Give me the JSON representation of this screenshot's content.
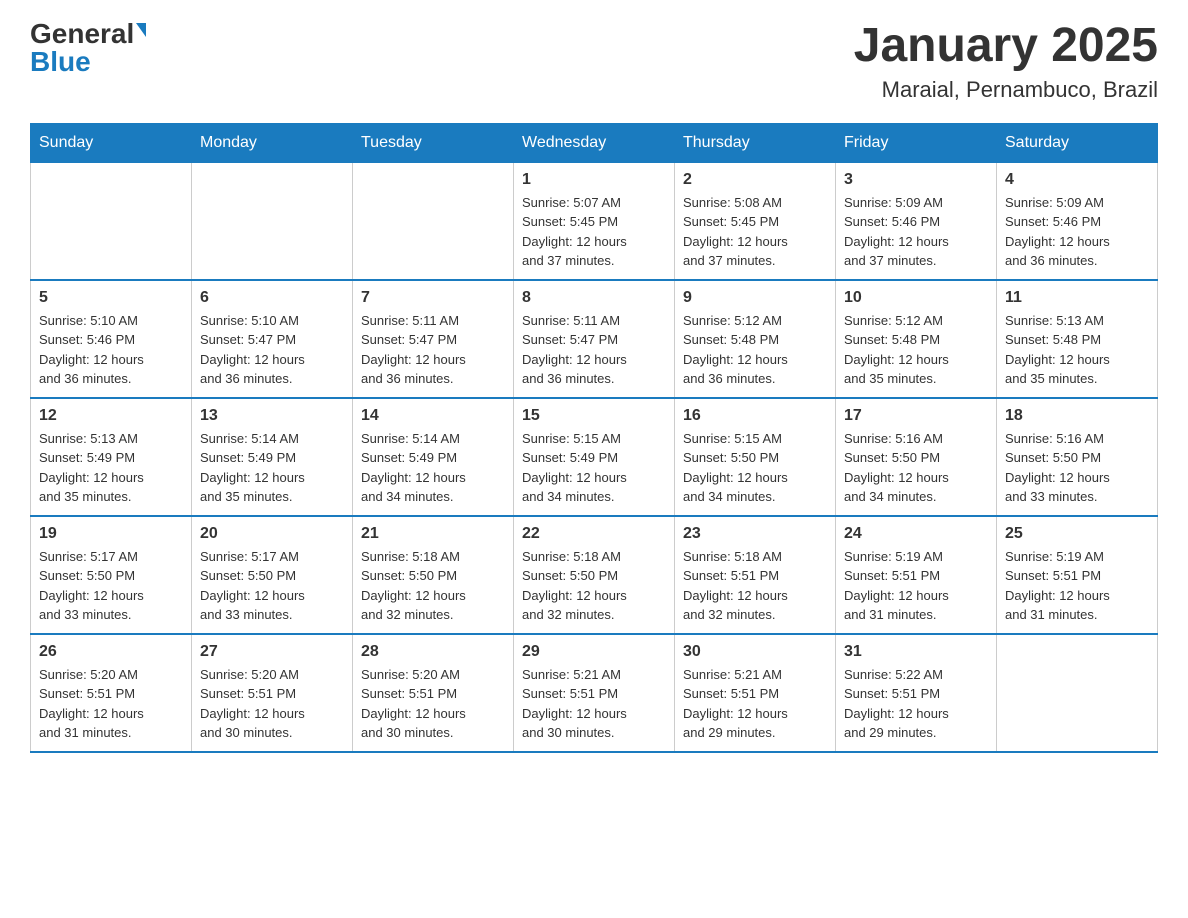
{
  "logo": {
    "general": "General",
    "blue": "Blue"
  },
  "title": "January 2025",
  "subtitle": "Maraial, Pernambuco, Brazil",
  "headers": [
    "Sunday",
    "Monday",
    "Tuesday",
    "Wednesday",
    "Thursday",
    "Friday",
    "Saturday"
  ],
  "weeks": [
    [
      {
        "day": "",
        "info": ""
      },
      {
        "day": "",
        "info": ""
      },
      {
        "day": "",
        "info": ""
      },
      {
        "day": "1",
        "info": "Sunrise: 5:07 AM\nSunset: 5:45 PM\nDaylight: 12 hours\nand 37 minutes."
      },
      {
        "day": "2",
        "info": "Sunrise: 5:08 AM\nSunset: 5:45 PM\nDaylight: 12 hours\nand 37 minutes."
      },
      {
        "day": "3",
        "info": "Sunrise: 5:09 AM\nSunset: 5:46 PM\nDaylight: 12 hours\nand 37 minutes."
      },
      {
        "day": "4",
        "info": "Sunrise: 5:09 AM\nSunset: 5:46 PM\nDaylight: 12 hours\nand 36 minutes."
      }
    ],
    [
      {
        "day": "5",
        "info": "Sunrise: 5:10 AM\nSunset: 5:46 PM\nDaylight: 12 hours\nand 36 minutes."
      },
      {
        "day": "6",
        "info": "Sunrise: 5:10 AM\nSunset: 5:47 PM\nDaylight: 12 hours\nand 36 minutes."
      },
      {
        "day": "7",
        "info": "Sunrise: 5:11 AM\nSunset: 5:47 PM\nDaylight: 12 hours\nand 36 minutes."
      },
      {
        "day": "8",
        "info": "Sunrise: 5:11 AM\nSunset: 5:47 PM\nDaylight: 12 hours\nand 36 minutes."
      },
      {
        "day": "9",
        "info": "Sunrise: 5:12 AM\nSunset: 5:48 PM\nDaylight: 12 hours\nand 36 minutes."
      },
      {
        "day": "10",
        "info": "Sunrise: 5:12 AM\nSunset: 5:48 PM\nDaylight: 12 hours\nand 35 minutes."
      },
      {
        "day": "11",
        "info": "Sunrise: 5:13 AM\nSunset: 5:48 PM\nDaylight: 12 hours\nand 35 minutes."
      }
    ],
    [
      {
        "day": "12",
        "info": "Sunrise: 5:13 AM\nSunset: 5:49 PM\nDaylight: 12 hours\nand 35 minutes."
      },
      {
        "day": "13",
        "info": "Sunrise: 5:14 AM\nSunset: 5:49 PM\nDaylight: 12 hours\nand 35 minutes."
      },
      {
        "day": "14",
        "info": "Sunrise: 5:14 AM\nSunset: 5:49 PM\nDaylight: 12 hours\nand 34 minutes."
      },
      {
        "day": "15",
        "info": "Sunrise: 5:15 AM\nSunset: 5:49 PM\nDaylight: 12 hours\nand 34 minutes."
      },
      {
        "day": "16",
        "info": "Sunrise: 5:15 AM\nSunset: 5:50 PM\nDaylight: 12 hours\nand 34 minutes."
      },
      {
        "day": "17",
        "info": "Sunrise: 5:16 AM\nSunset: 5:50 PM\nDaylight: 12 hours\nand 34 minutes."
      },
      {
        "day": "18",
        "info": "Sunrise: 5:16 AM\nSunset: 5:50 PM\nDaylight: 12 hours\nand 33 minutes."
      }
    ],
    [
      {
        "day": "19",
        "info": "Sunrise: 5:17 AM\nSunset: 5:50 PM\nDaylight: 12 hours\nand 33 minutes."
      },
      {
        "day": "20",
        "info": "Sunrise: 5:17 AM\nSunset: 5:50 PM\nDaylight: 12 hours\nand 33 minutes."
      },
      {
        "day": "21",
        "info": "Sunrise: 5:18 AM\nSunset: 5:50 PM\nDaylight: 12 hours\nand 32 minutes."
      },
      {
        "day": "22",
        "info": "Sunrise: 5:18 AM\nSunset: 5:50 PM\nDaylight: 12 hours\nand 32 minutes."
      },
      {
        "day": "23",
        "info": "Sunrise: 5:18 AM\nSunset: 5:51 PM\nDaylight: 12 hours\nand 32 minutes."
      },
      {
        "day": "24",
        "info": "Sunrise: 5:19 AM\nSunset: 5:51 PM\nDaylight: 12 hours\nand 31 minutes."
      },
      {
        "day": "25",
        "info": "Sunrise: 5:19 AM\nSunset: 5:51 PM\nDaylight: 12 hours\nand 31 minutes."
      }
    ],
    [
      {
        "day": "26",
        "info": "Sunrise: 5:20 AM\nSunset: 5:51 PM\nDaylight: 12 hours\nand 31 minutes."
      },
      {
        "day": "27",
        "info": "Sunrise: 5:20 AM\nSunset: 5:51 PM\nDaylight: 12 hours\nand 30 minutes."
      },
      {
        "day": "28",
        "info": "Sunrise: 5:20 AM\nSunset: 5:51 PM\nDaylight: 12 hours\nand 30 minutes."
      },
      {
        "day": "29",
        "info": "Sunrise: 5:21 AM\nSunset: 5:51 PM\nDaylight: 12 hours\nand 30 minutes."
      },
      {
        "day": "30",
        "info": "Sunrise: 5:21 AM\nSunset: 5:51 PM\nDaylight: 12 hours\nand 29 minutes."
      },
      {
        "day": "31",
        "info": "Sunrise: 5:22 AM\nSunset: 5:51 PM\nDaylight: 12 hours\nand 29 minutes."
      },
      {
        "day": "",
        "info": ""
      }
    ]
  ]
}
